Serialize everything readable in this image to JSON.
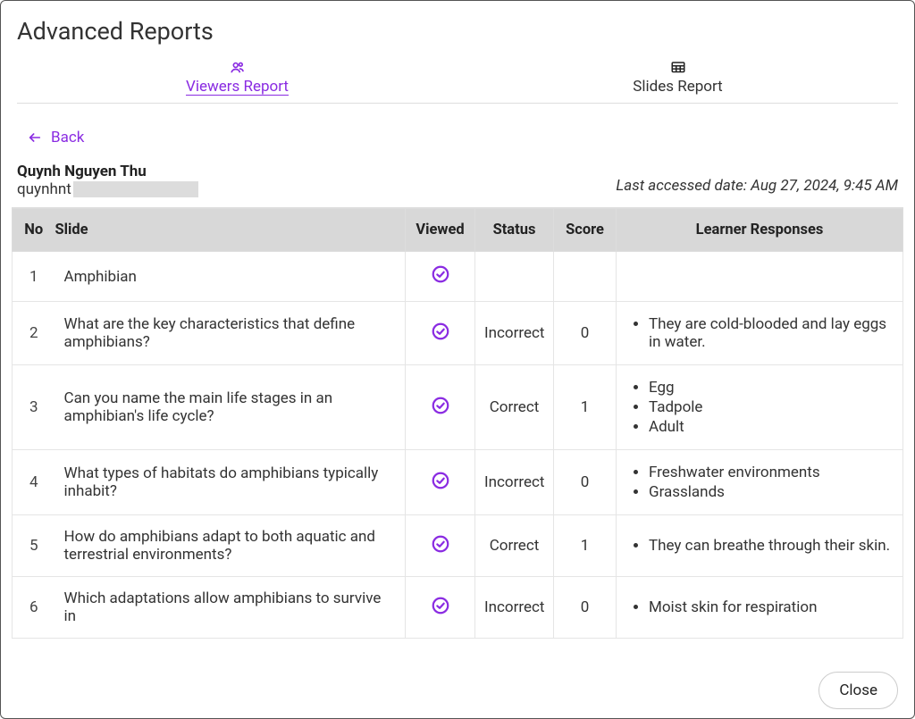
{
  "title": "Advanced Reports",
  "tabs": {
    "viewers": "Viewers Report",
    "slides": "Slides Report"
  },
  "back_label": "Back",
  "user": {
    "name": "Quynh Nguyen Thu",
    "email_prefix": "quynhnt"
  },
  "last_accessed_label": "Last accessed date: Aug 27, 2024, 9:45 AM",
  "columns": {
    "no": "No",
    "slide": "Slide",
    "viewed": "Viewed",
    "status": "Status",
    "score": "Score",
    "responses": "Learner Responses"
  },
  "rows": [
    {
      "no": "1",
      "slide": "Amphibian",
      "viewed": true,
      "status": "",
      "score": "",
      "responses": []
    },
    {
      "no": "2",
      "slide": "What are the key characteristics that define amphibians?",
      "viewed": true,
      "status": "Incorrect",
      "score": "0",
      "responses": [
        "They are cold-blooded and lay eggs in water."
      ]
    },
    {
      "no": "3",
      "slide": "Can you name the main life stages in an amphibian's life cycle?",
      "viewed": true,
      "status": "Correct",
      "score": "1",
      "responses": [
        "Egg",
        "Tadpole",
        "Adult"
      ]
    },
    {
      "no": "4",
      "slide": "What types of habitats do amphibians typically inhabit?",
      "viewed": true,
      "status": "Incorrect",
      "score": "0",
      "responses": [
        "Freshwater environments",
        "Grasslands"
      ]
    },
    {
      "no": "5",
      "slide": "How do amphibians adapt to both aquatic and terrestrial environments?",
      "viewed": true,
      "status": "Correct",
      "score": "1",
      "responses": [
        "They can breathe through their skin."
      ]
    },
    {
      "no": "6",
      "slide": "Which adaptations allow amphibians to survive in",
      "viewed": true,
      "status": "Incorrect",
      "score": "0",
      "responses": [
        "Moist skin for respiration"
      ]
    }
  ],
  "close_label": "Close",
  "colors": {
    "accent": "#8a2be2"
  }
}
